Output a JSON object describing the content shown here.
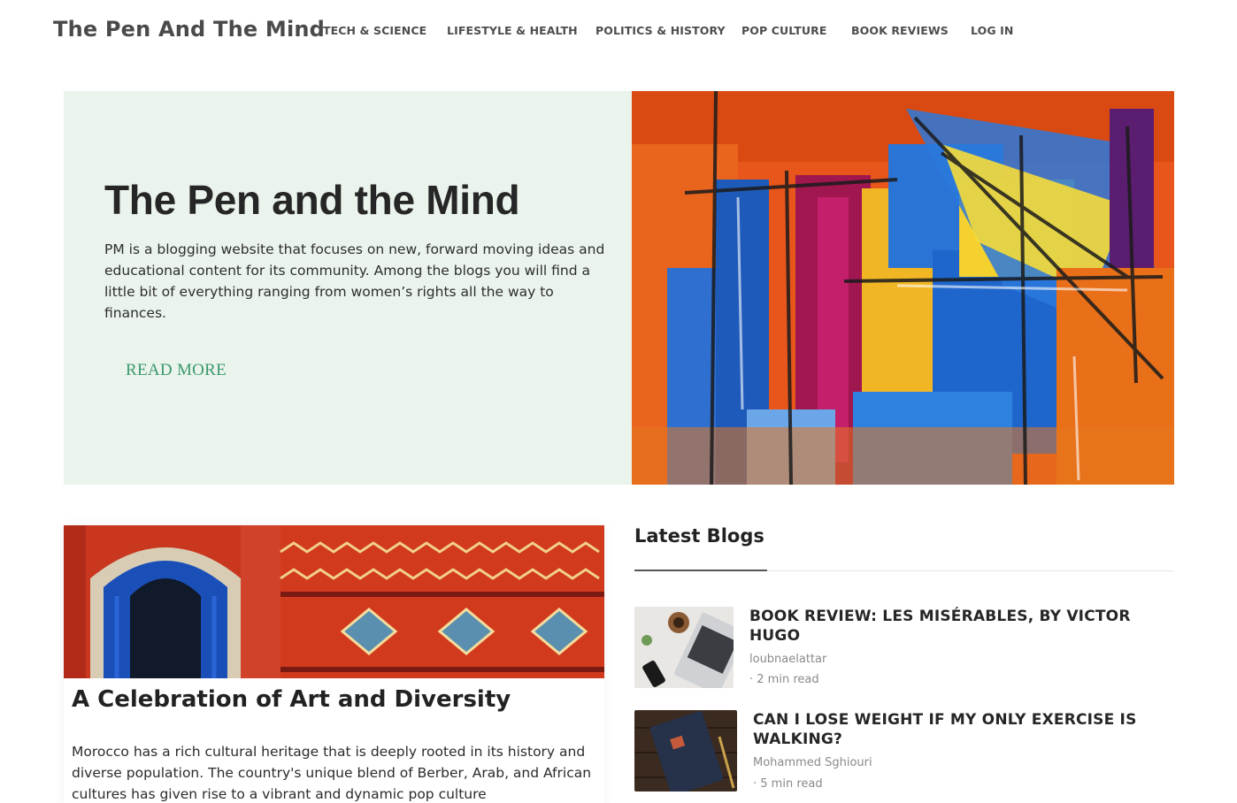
{
  "site": {
    "logo": "The Pen And The Mind"
  },
  "nav": {
    "items": [
      {
        "label": "TECH & SCIENCE"
      },
      {
        "label": "LIFESTYLE & HEALTH"
      },
      {
        "label": "POLITICS & HISTORY"
      },
      {
        "label": "POP CULTURE"
      },
      {
        "label": "BOOK REVIEWS"
      },
      {
        "label": "LOG IN"
      }
    ]
  },
  "hero": {
    "title": "The Pen and the Mind",
    "description": "PM is a blogging website that focuses on new, forward moving ideas and educational content for its community. Among the blogs you will find a little bit of everything ranging from women’s rights all the way to finances.",
    "read_more": "READ MORE",
    "accent_color": "#3a9a6c",
    "background_color": "#eaf3ec"
  },
  "feature": {
    "title": "A Celebration of Art and Diversity",
    "text": "Morocco has a rich cultural heritage that is deeply rooted in its history and diverse population. The country's unique blend of Berber, Arab, and African cultures has given rise to a vibrant and dynamic pop culture"
  },
  "latest": {
    "title": "Latest Blogs",
    "posts": [
      {
        "title": "BOOK REVIEW: LES MISÉRABLES, BY VICTOR HUGO",
        "author": "loubnaelattar",
        "read_time": "· 2 min read"
      },
      {
        "title": "CAN I LOSE WEIGHT IF MY ONLY EXERCISE IS WALKING?",
        "author": "Mohammed Sghiouri",
        "read_time": "· 5 min read"
      }
    ]
  }
}
